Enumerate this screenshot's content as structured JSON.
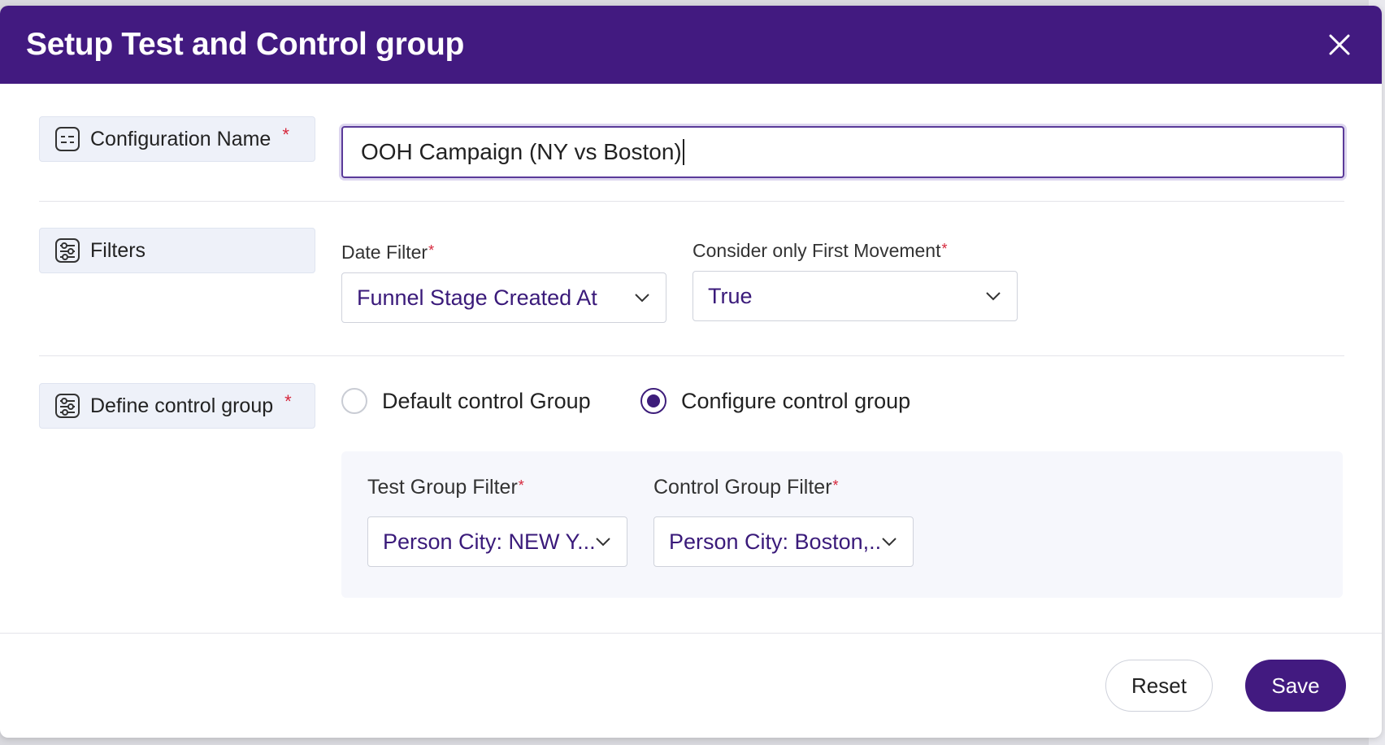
{
  "dialog": {
    "title": "Setup Test and Control group",
    "close_icon": "close-icon"
  },
  "config_name": {
    "label": "Configuration Name",
    "required_mark": "*",
    "value": "OOH Campaign (NY vs Boston)",
    "icon": "form-field-icon"
  },
  "filters": {
    "label": "Filters",
    "icon": "sliders-icon",
    "date_filter": {
      "label": "Date Filter",
      "required_mark": "*",
      "value": "Funnel Stage Created At"
    },
    "first_movement": {
      "label": "Consider only First Movement",
      "required_mark": "*",
      "value": "True"
    }
  },
  "control_group": {
    "label": "Define control group",
    "required_mark": "*",
    "icon": "sliders-icon",
    "options": [
      {
        "label": "Default control Group",
        "checked": false
      },
      {
        "label": "Configure control group",
        "checked": true
      }
    ],
    "test_filter": {
      "label": "Test Group Filter",
      "required_mark": "*",
      "value": "Person City: NEW Y..."
    },
    "control_filter": {
      "label": "Control Group Filter",
      "required_mark": "*",
      "value": "Person City: Boston,..."
    }
  },
  "footer": {
    "reset_label": "Reset",
    "save_label": "Save"
  },
  "colors": {
    "primary": "#421a80",
    "accent_text": "#3a1a7a",
    "required": "#d6263b",
    "label_bg": "#eef1f9"
  }
}
